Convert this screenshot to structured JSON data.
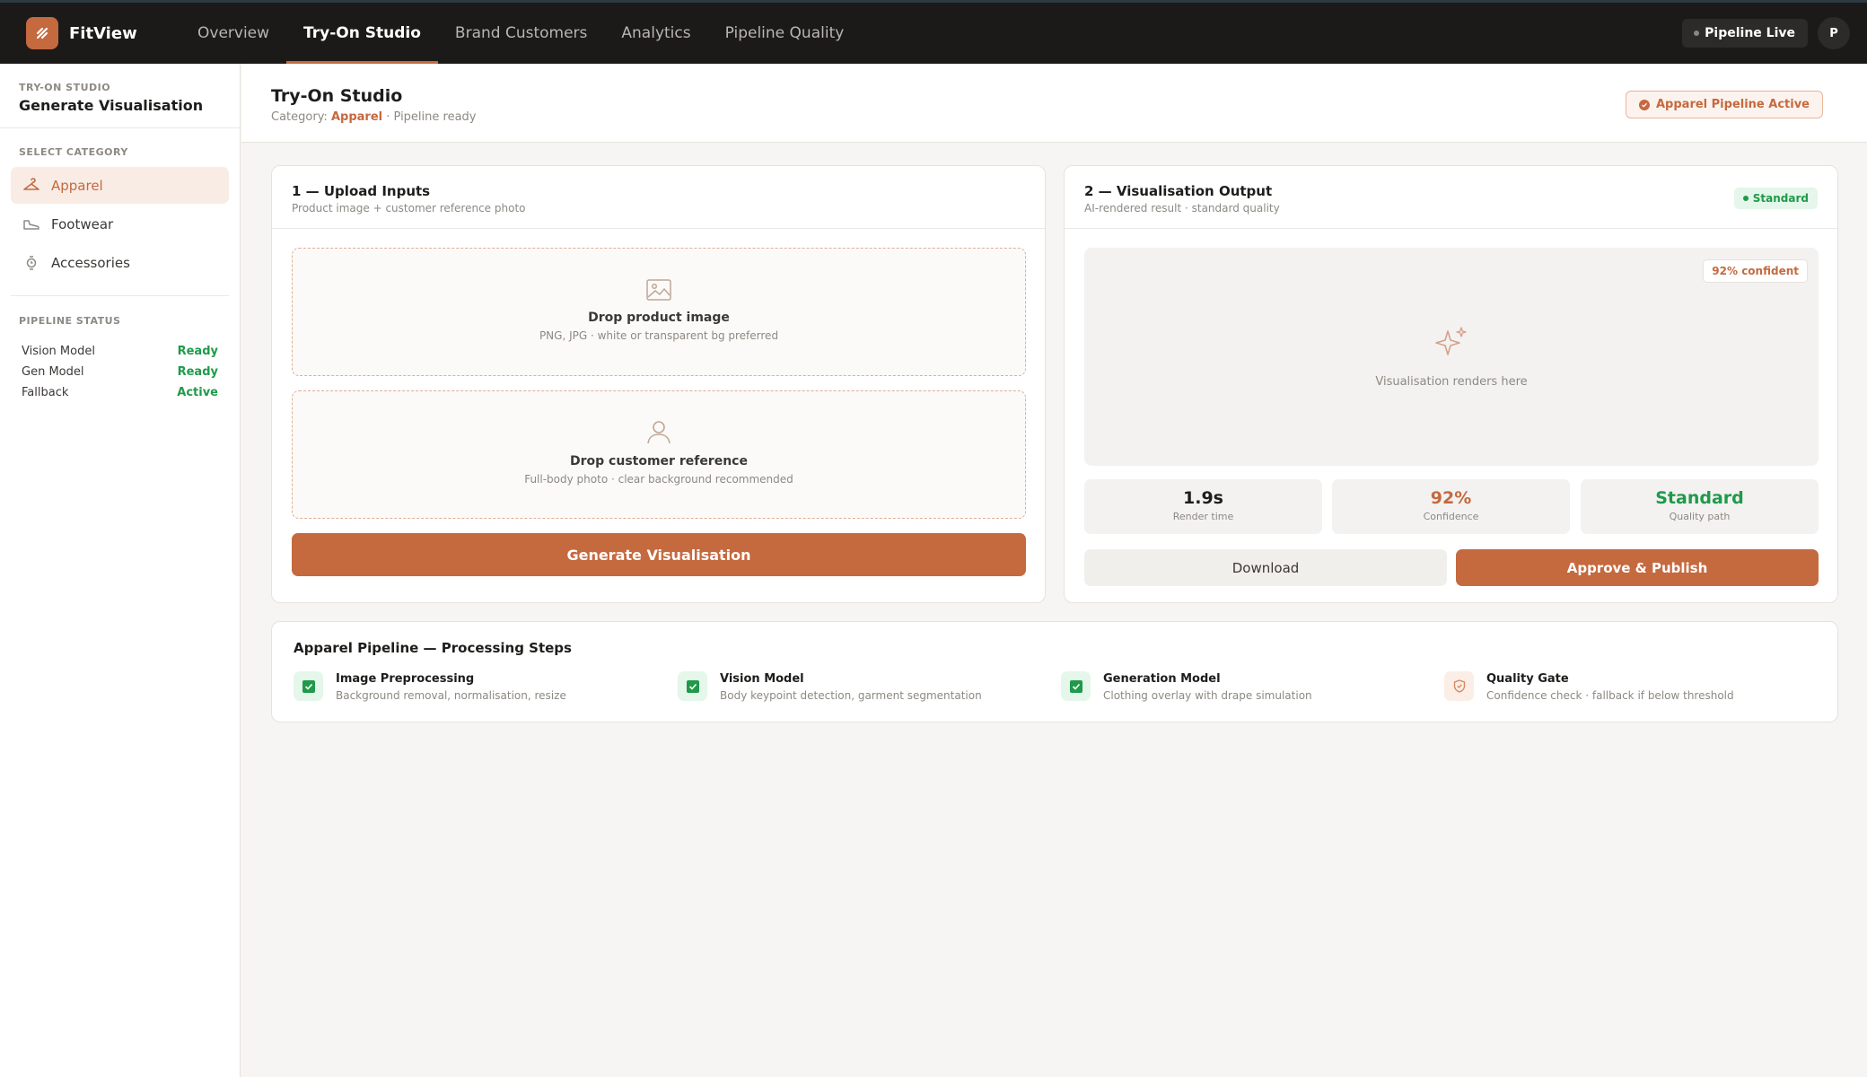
{
  "app": {
    "name": "FitView"
  },
  "nav": {
    "tabs": [
      "Overview",
      "Try-On Studio",
      "Brand Customers",
      "Analytics",
      "Pipeline Quality"
    ],
    "active": "Try-On Studio"
  },
  "topbar": {
    "pipeline_status": "Pipeline Live",
    "avatar_initial": "P"
  },
  "sidebar": {
    "eyebrow": "TRY-ON STUDIO",
    "title": "Generate Visualisation",
    "category_heading": "SELECT CATEGORY",
    "categories": [
      {
        "label": "Apparel",
        "icon": "hanger-icon",
        "active": true
      },
      {
        "label": "Footwear",
        "icon": "shoe-icon",
        "active": false
      },
      {
        "label": "Accessories",
        "icon": "watch-icon",
        "active": false
      }
    ],
    "status_heading": "PIPELINE STATUS",
    "status": [
      {
        "label": "Vision Model",
        "value": "Ready"
      },
      {
        "label": "Gen Model",
        "value": "Ready"
      },
      {
        "label": "Fallback",
        "value": "Active"
      }
    ]
  },
  "header": {
    "title": "Try-On Studio",
    "category_prefix": "Category:",
    "category": "Apparel",
    "state": "· Pipeline ready",
    "badge": "Apparel Pipeline Active"
  },
  "upload": {
    "title": "1 — Upload Inputs",
    "subtitle": "Product image + customer reference photo",
    "product_drop": {
      "title": "Drop product image",
      "hint": "PNG, JPG · white or transparent bg preferred"
    },
    "customer_drop": {
      "title": "Drop customer reference",
      "hint": "Full-body photo · clear background recommended"
    },
    "generate_label": "Generate Visualisation"
  },
  "output": {
    "title": "2 — Visualisation Output",
    "subtitle": "AI-rendered result · standard quality",
    "quality_badge": "Standard",
    "confidence_badge": "92% confident",
    "placeholder": "Visualisation renders here",
    "metrics": [
      {
        "value": "1.9s",
        "label": "Render time"
      },
      {
        "value": "92%",
        "label": "Confidence"
      },
      {
        "value": "Standard",
        "label": "Quality path"
      }
    ],
    "download_label": "Download",
    "publish_label": "Approve & Publish"
  },
  "steps": {
    "title": "Apparel Pipeline — Processing Steps",
    "items": [
      {
        "title": "Image Preprocessing",
        "desc": "Background removal, normalisation, resize",
        "state": "done"
      },
      {
        "title": "Vision Model",
        "desc": "Body keypoint detection, garment segmentation",
        "state": "done"
      },
      {
        "title": "Generation Model",
        "desc": "Clothing overlay with drape simulation",
        "state": "done"
      },
      {
        "title": "Quality Gate",
        "desc": "Confidence check · fallback if below threshold",
        "state": "pending"
      }
    ]
  },
  "colors": {
    "accent": "#c5693f",
    "topbar": "#1b1a19",
    "success": "#1f9a4a"
  }
}
